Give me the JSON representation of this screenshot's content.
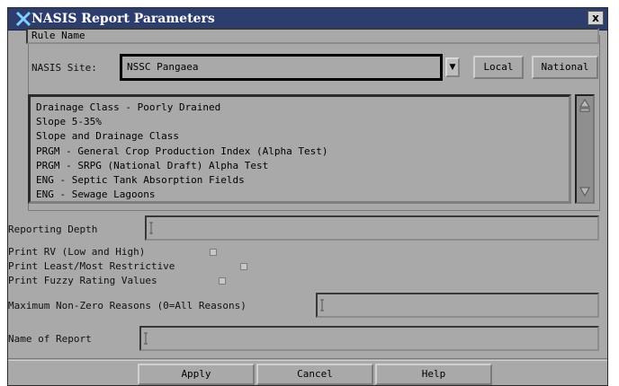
{
  "window": {
    "title": "NASIS Report Parameters",
    "close_label": "x"
  },
  "rule_name": {
    "label": "Rule Name"
  },
  "site": {
    "label": "NASIS Site:",
    "value": "NSSC Pangaea",
    "local_label": "Local",
    "national_label": "National"
  },
  "rules_list": {
    "items": [
      "Drainage Class - Poorly Drained",
      "Slope 5-35%",
      "Slope and Drainage Class",
      "PRGM - General Crop Production Index (Alpha Test)",
      "PRGM - SRPG (National Draft) Alpha Test",
      "ENG - Septic Tank Absorption Fields",
      "ENG - Sewage Lagoons"
    ]
  },
  "reporting_depth": {
    "label": "Reporting Depth",
    "value": ""
  },
  "options": {
    "print_rv": "Print RV (Low and High)",
    "print_least_most": "Print Least/Most Restrictive",
    "print_fuzzy": "Print Fuzzy Rating Values"
  },
  "max_reasons": {
    "label": "Maximum Non-Zero Reasons (0=All Reasons)",
    "value": ""
  },
  "report_name": {
    "label": "Name of Report",
    "value": ""
  },
  "actions": {
    "apply": "Apply",
    "cancel": "Cancel",
    "help": "Help"
  },
  "colors": {
    "titlebar": "#2d3e6e",
    "panel": "#a9a9a9"
  },
  "icons": [
    "app-x-icon",
    "close-icon",
    "dropdown-arrow-icon",
    "scroll-up-arrow-icon",
    "scroll-down-arrow-icon",
    "text-cursor-icon"
  ]
}
